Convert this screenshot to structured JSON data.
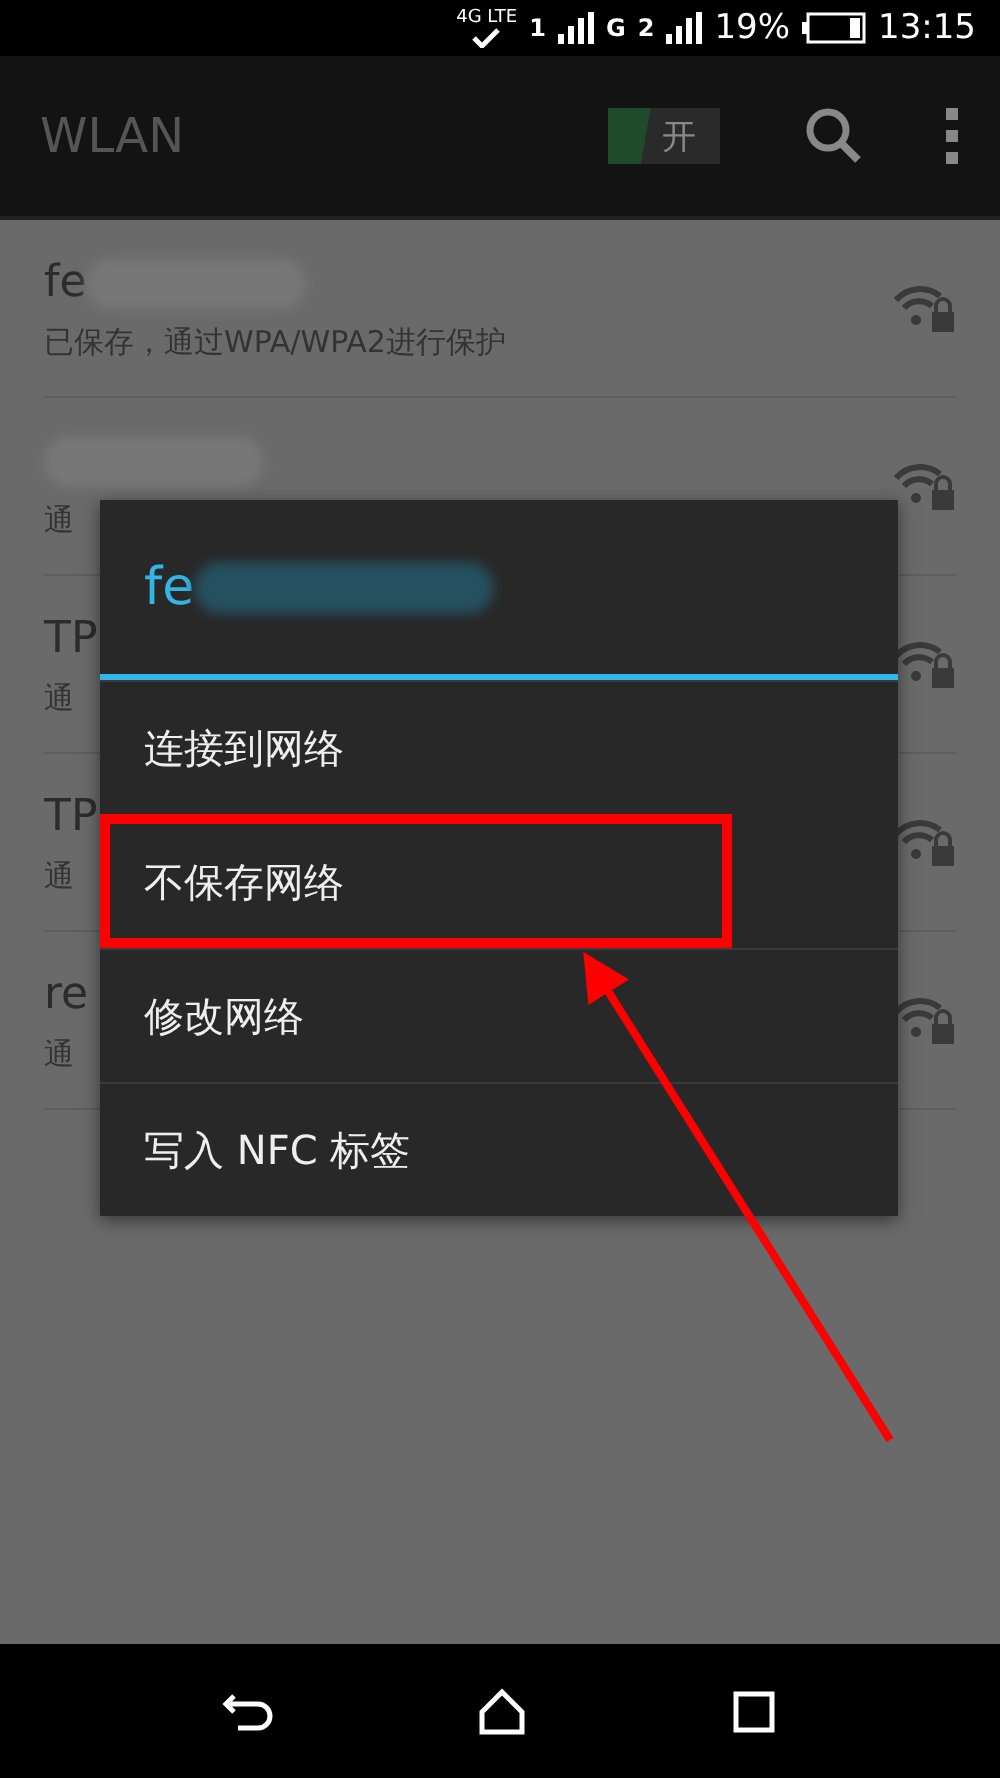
{
  "status_bar": {
    "network": "4G LTE",
    "sim1": "1",
    "sim2_network": "G",
    "sim2": "2",
    "battery": "19%",
    "time": "13:15"
  },
  "action_bar": {
    "title": "WLAN",
    "toggle": {
      "label": "开",
      "on": true
    }
  },
  "networks": [
    {
      "name": "fe",
      "detail": "已保存，通过WPA/WPA2进行保护",
      "blurred": true
    },
    {
      "detail": "通",
      "blurred": true
    },
    {
      "name": "TP",
      "detail": "通",
      "blurred": false
    },
    {
      "name": "TP",
      "detail": "通",
      "blurred": false
    },
    {
      "name": "re",
      "detail": "通",
      "blurred": false
    }
  ],
  "dialog": {
    "title": "fe",
    "title_blurred": true,
    "items": [
      {
        "label": "连接到网络",
        "highlighted": false
      },
      {
        "label": "不保存网络",
        "highlighted": true
      },
      {
        "label": "修改网络",
        "highlighted": false
      },
      {
        "label": "写入 NFC 标签",
        "highlighted": false
      }
    ]
  }
}
